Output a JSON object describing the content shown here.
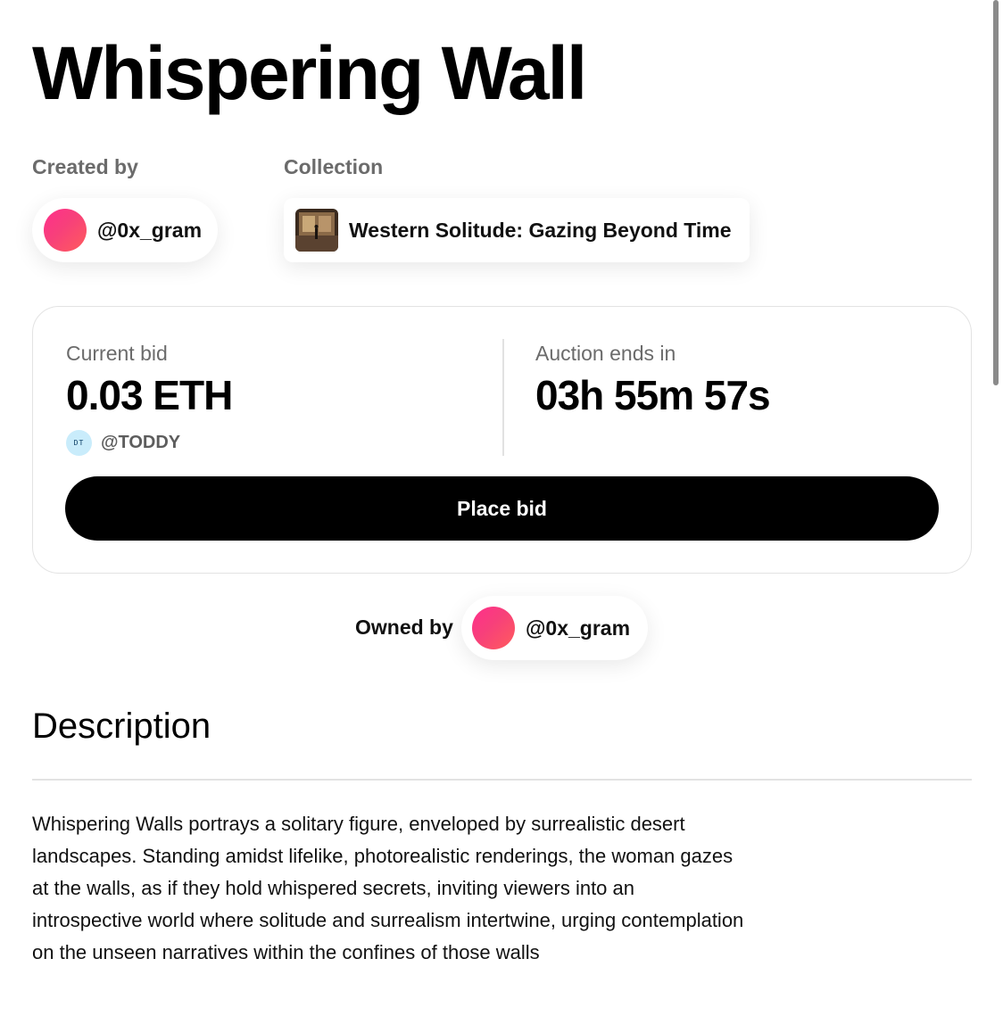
{
  "title": "Whispering Wall",
  "creator": {
    "label": "Created by",
    "handle": "@0x_gram"
  },
  "collection": {
    "label": "Collection",
    "name": "Western Solitude: Gazing Beyond Time"
  },
  "bid": {
    "current_label": "Current bid",
    "current_value": "0.03 ETH",
    "bidder_handle": "@TODDY",
    "bidder_avatar_text": "DT",
    "auction_label": "Auction ends in",
    "auction_value": "03h 55m 57s",
    "button_label": "Place bid"
  },
  "owner": {
    "label": "Owned by",
    "handle": "@0x_gram"
  },
  "description": {
    "heading": "Description",
    "text": "Whispering Walls portrays a solitary figure, enveloped by surrealistic desert landscapes. Standing amidst lifelike, photorealistic renderings, the woman gazes at the walls, as if they hold whispered secrets, inviting viewers into an introspective world where solitude and surrealism intertwine, urging contemplation on the unseen narratives within the confines of those walls"
  },
  "colors": {
    "accent_pink": "#ff2f8c",
    "button_bg": "#000000",
    "muted_text": "#6b6b6b"
  },
  "icons": {
    "creator_avatar": "pink-gradient-avatar-icon",
    "collection_thumb": "collection-thumbnail-icon",
    "bidder_avatar": "bidder-avatar-icon",
    "owner_avatar": "pink-gradient-avatar-icon"
  }
}
